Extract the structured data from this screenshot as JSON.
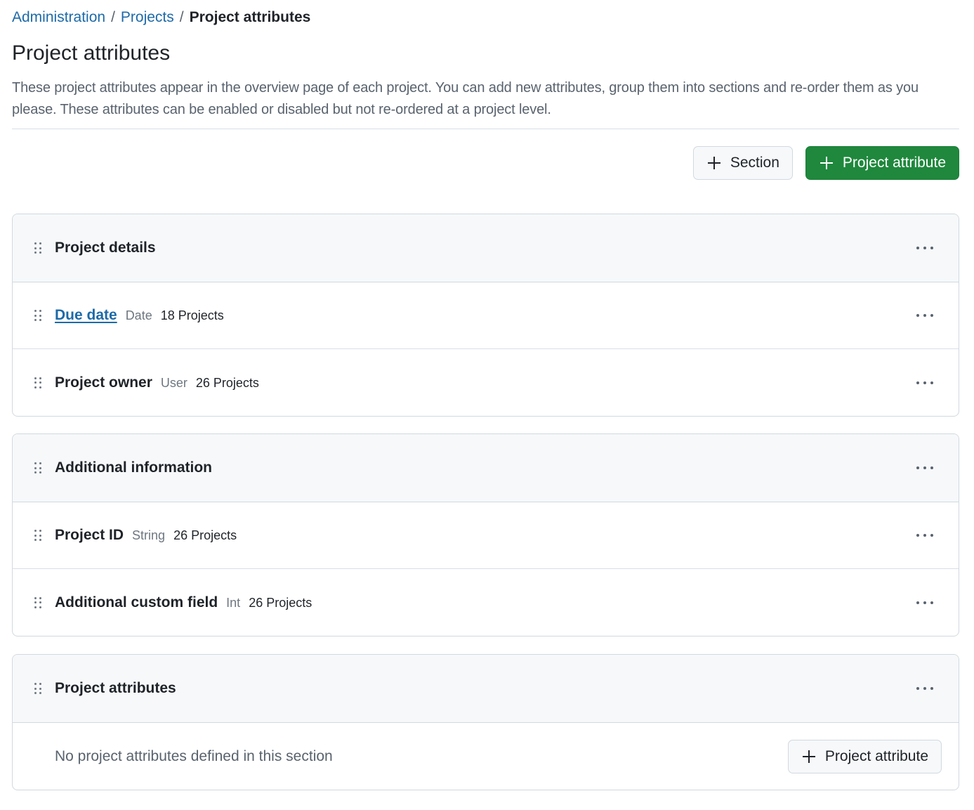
{
  "breadcrumb": {
    "items": [
      "Administration",
      "Projects"
    ],
    "separator": "/",
    "current": "Project attributes"
  },
  "page": {
    "title": "Project attributes",
    "description": "These project attributes appear in the overview page of each project. You can add new attributes, group them into sections and re-order them as you please. These attributes can be enabled or disabled but not re-ordered at a project level."
  },
  "toolbar": {
    "add_section_label": "Section",
    "add_attribute_label": "Project attribute"
  },
  "colors": {
    "primary_green": "#1f883d",
    "link_blue": "#1d6aa8",
    "header_bg": "#f6f8fa",
    "border": "#d1d9e0"
  },
  "sections": [
    {
      "title": "Project details",
      "attributes": [
        {
          "name": "Due date",
          "type": "Date",
          "count": "18 Projects",
          "is_link": true
        },
        {
          "name": "Project owner",
          "type": "User",
          "count": "26 Projects",
          "is_link": false
        }
      ]
    },
    {
      "title": "Additional information",
      "attributes": [
        {
          "name": "Project ID",
          "type": "String",
          "count": "26 Projects",
          "is_link": false
        },
        {
          "name": "Additional custom field",
          "type": "Int",
          "count": "26 Projects",
          "is_link": false
        }
      ]
    },
    {
      "title": "Project attributes",
      "attributes": [],
      "empty_text": "No project attributes defined in this section",
      "add_attribute_label": "Project attribute"
    }
  ],
  "icons": {
    "drag_handle": "grabber-icon",
    "more_menu": "kebab-horizontal-icon",
    "add": "plus-icon"
  }
}
